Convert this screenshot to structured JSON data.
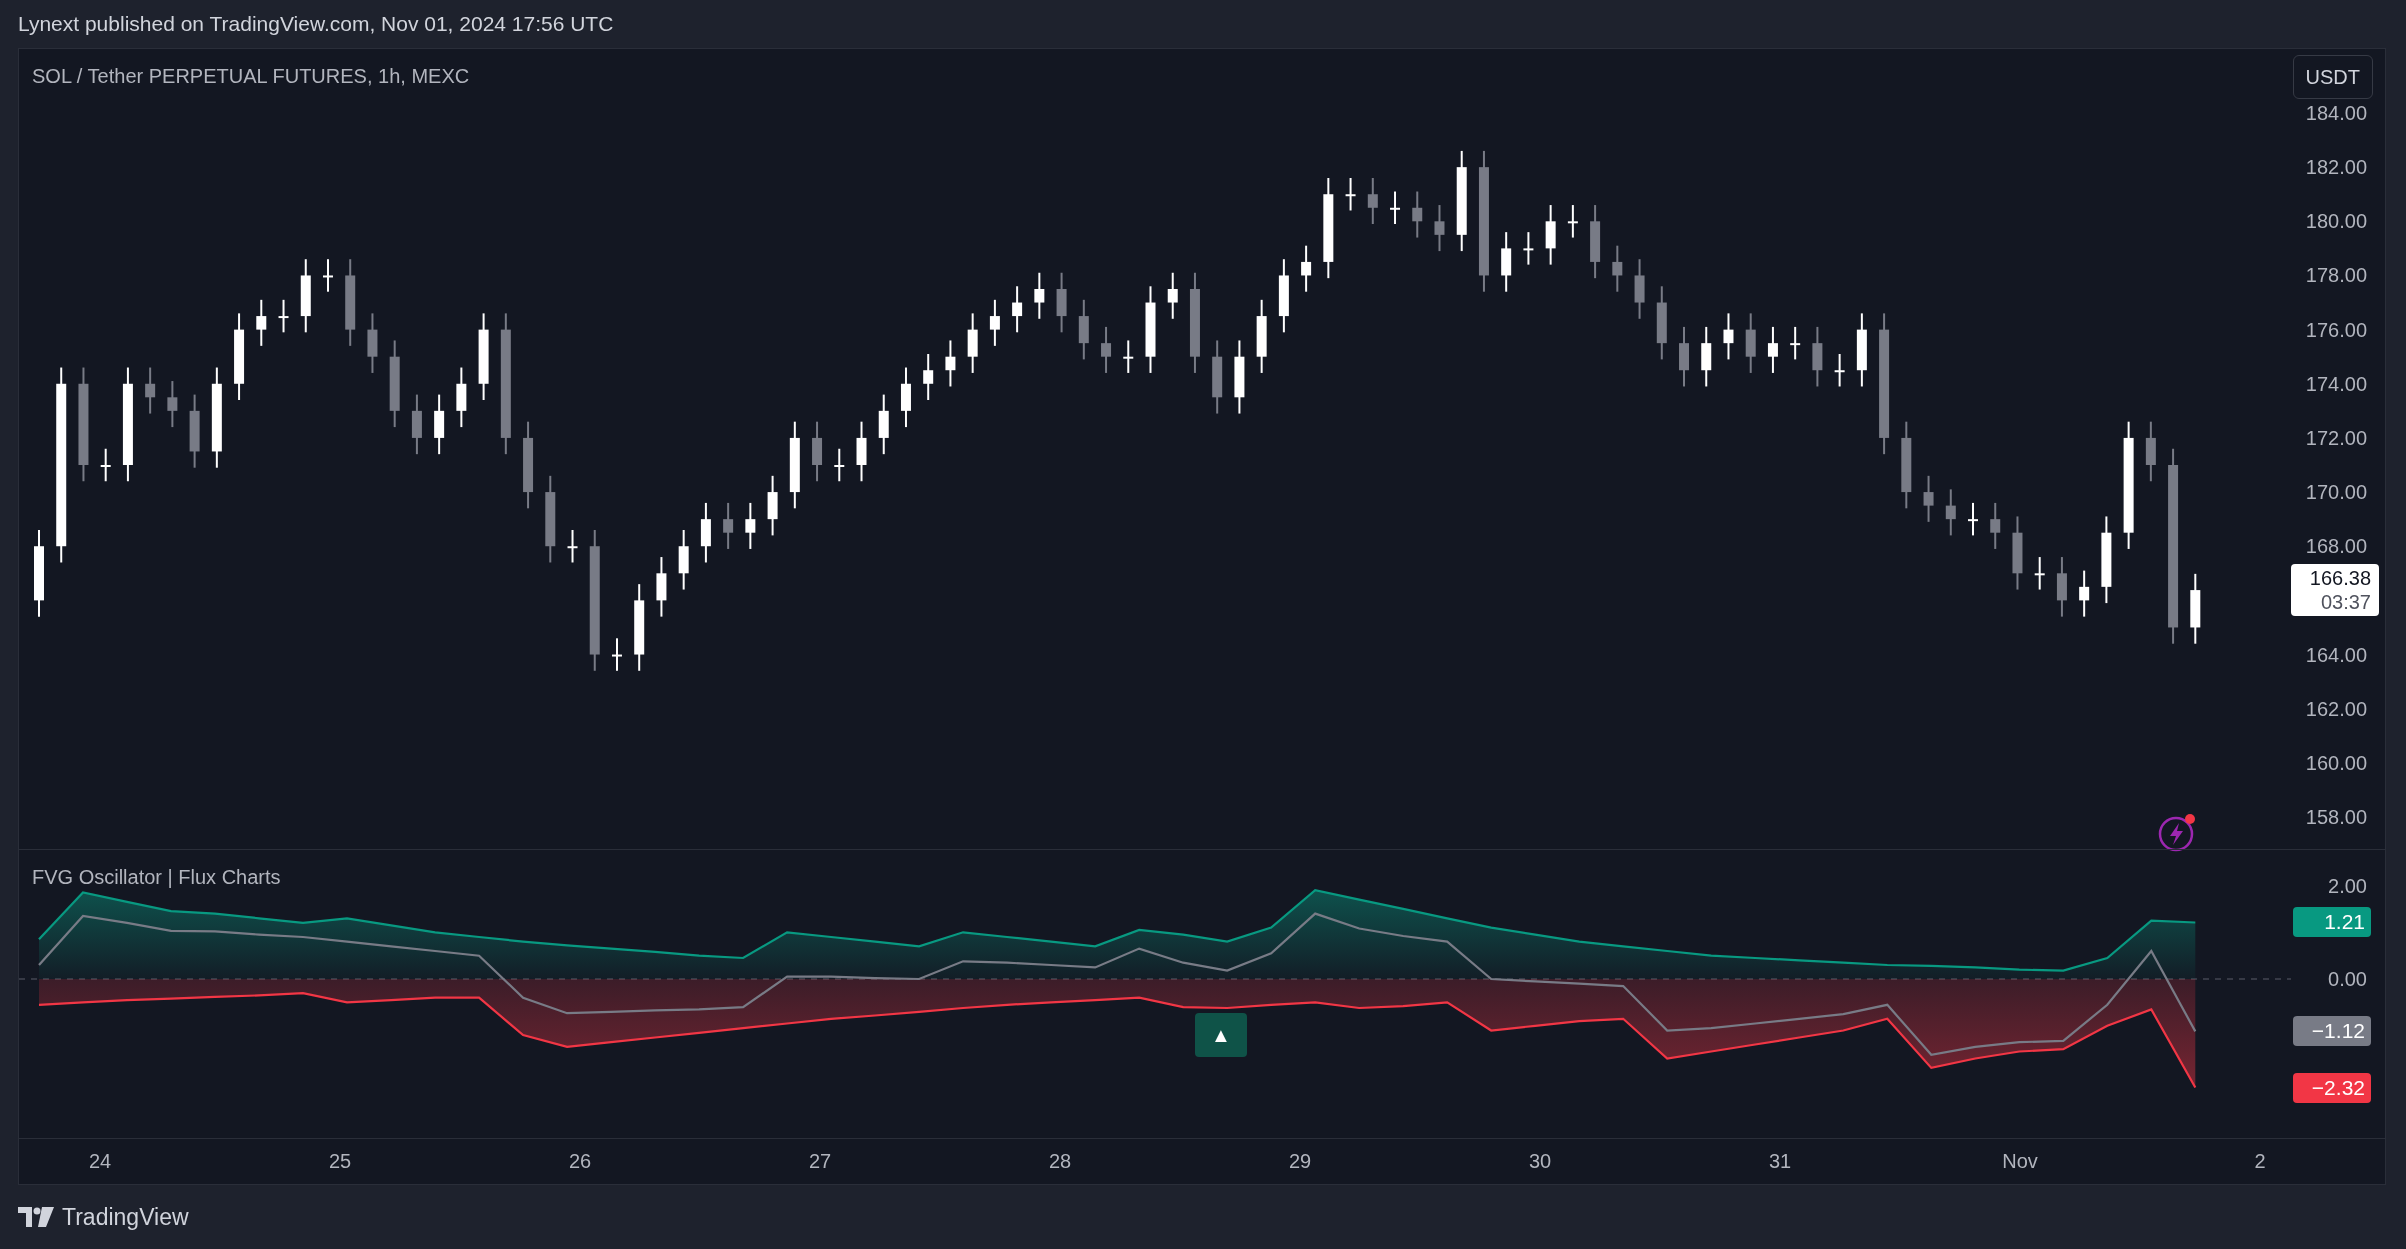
{
  "header": {
    "text": "Lynext published on TradingView.com, Nov 01, 2024 17:56 UTC"
  },
  "price_pane": {
    "symbol": "SOL / Tether PERPETUAL FUTURES, 1h, MEXC",
    "currency_button": "USDT",
    "last_price": "166.38",
    "countdown": "03:37",
    "chart_data": {
      "type": "candlestick",
      "ylim": [
        158,
        184
      ],
      "categories": [
        null,
        null,
        null,
        null,
        null,
        null,
        null,
        null,
        null,
        null,
        null,
        null,
        null,
        null,
        null,
        null,
        null,
        null,
        null,
        null,
        null,
        null,
        null,
        null,
        null,
        null,
        null,
        null,
        null,
        null,
        null,
        null,
        null,
        null,
        null,
        null,
        null,
        null,
        null,
        null,
        null,
        null,
        null,
        null,
        null,
        null,
        null,
        null,
        null,
        null,
        null,
        null,
        null,
        null,
        null,
        null,
        null,
        null,
        null,
        null,
        null,
        null,
        null,
        null,
        null,
        null,
        null,
        null,
        null,
        null,
        null,
        null,
        null,
        null,
        null,
        null,
        null,
        null,
        null,
        null,
        null,
        null,
        null,
        null,
        null,
        null,
        null,
        null,
        null,
        null,
        null,
        null,
        null,
        null,
        null,
        null,
        null,
        null
      ],
      "ohlc": [
        [
          166,
          168.6,
          165.4,
          168
        ],
        [
          168,
          174.6,
          167.4,
          174
        ],
        [
          174,
          174.6,
          170.4,
          171
        ],
        [
          171,
          171.6,
          170.4,
          171
        ],
        [
          171,
          174.6,
          170.4,
          174
        ],
        [
          174,
          174.6,
          172.9,
          173.5
        ],
        [
          173.5,
          174.1,
          172.4,
          173
        ],
        [
          173,
          173.6,
          170.9,
          171.5
        ],
        [
          171.5,
          174.6,
          170.9,
          174
        ],
        [
          174,
          176.6,
          173.4,
          176
        ],
        [
          176,
          177.1,
          175.4,
          176.5
        ],
        [
          176.5,
          177.1,
          175.9,
          176.5
        ],
        [
          176.5,
          178.6,
          175.9,
          178
        ],
        [
          178,
          178.6,
          177.4,
          178
        ],
        [
          178,
          178.6,
          175.4,
          176
        ],
        [
          176,
          176.6,
          174.4,
          175
        ],
        [
          175,
          175.6,
          172.4,
          173
        ],
        [
          173,
          173.6,
          171.4,
          172
        ],
        [
          172,
          173.6,
          171.4,
          173
        ],
        [
          173,
          174.6,
          172.4,
          174
        ],
        [
          174,
          176.6,
          173.4,
          176
        ],
        [
          176,
          176.6,
          171.4,
          172
        ],
        [
          172,
          172.6,
          169.4,
          170
        ],
        [
          170,
          170.6,
          167.4,
          168
        ],
        [
          168,
          168.6,
          167.4,
          168
        ],
        [
          168,
          168.6,
          163.4,
          164
        ],
        [
          164,
          164.6,
          163.4,
          164
        ],
        [
          164,
          166.6,
          163.4,
          166
        ],
        [
          166,
          167.6,
          165.4,
          167
        ],
        [
          167,
          168.6,
          166.4,
          168
        ],
        [
          168,
          169.6,
          167.4,
          169
        ],
        [
          169,
          169.6,
          167.9,
          168.5
        ],
        [
          168.5,
          169.6,
          167.9,
          169
        ],
        [
          169,
          170.6,
          168.4,
          170
        ],
        [
          170,
          172.6,
          169.4,
          172
        ],
        [
          172,
          172.6,
          170.4,
          171
        ],
        [
          171,
          171.6,
          170.4,
          171
        ],
        [
          171,
          172.6,
          170.4,
          172
        ],
        [
          172,
          173.6,
          171.4,
          173
        ],
        [
          173,
          174.6,
          172.4,
          174
        ],
        [
          174,
          175.1,
          173.4,
          174.5
        ],
        [
          174.5,
          175.6,
          173.9,
          175
        ],
        [
          175,
          176.6,
          174.4,
          176
        ],
        [
          176,
          177.1,
          175.4,
          176.5
        ],
        [
          176.5,
          177.6,
          175.9,
          177
        ],
        [
          177,
          178.1,
          176.4,
          177.5
        ],
        [
          177.5,
          178.1,
          175.9,
          176.5
        ],
        [
          176.5,
          177.1,
          174.9,
          175.5
        ],
        [
          175.5,
          176.1,
          174.4,
          175
        ],
        [
          175,
          175.6,
          174.4,
          175
        ],
        [
          175,
          177.6,
          174.4,
          177
        ],
        [
          177,
          178.1,
          176.4,
          177.5
        ],
        [
          177.5,
          178.1,
          174.4,
          175
        ],
        [
          175,
          175.6,
          172.9,
          173.5
        ],
        [
          173.5,
          175.6,
          172.9,
          175
        ],
        [
          175,
          177.1,
          174.4,
          176.5
        ],
        [
          176.5,
          178.6,
          175.9,
          178
        ],
        [
          178,
          179.1,
          177.4,
          178.5
        ],
        [
          178.5,
          181.6,
          177.9,
          181
        ],
        [
          181,
          181.6,
          180.4,
          181
        ],
        [
          181,
          181.6,
          179.9,
          180.5
        ],
        [
          180.5,
          181.1,
          179.9,
          180.5
        ],
        [
          180.5,
          181.1,
          179.4,
          180
        ],
        [
          180,
          180.6,
          178.9,
          179.5
        ],
        [
          179.5,
          182.6,
          178.9,
          182
        ],
        [
          182,
          182.6,
          177.4,
          178
        ],
        [
          178,
          179.6,
          177.4,
          179
        ],
        [
          179,
          179.6,
          178.4,
          179
        ],
        [
          179,
          180.6,
          178.4,
          180
        ],
        [
          180,
          180.6,
          179.4,
          180
        ],
        [
          180,
          180.6,
          177.9,
          178.5
        ],
        [
          178.5,
          179.1,
          177.4,
          178
        ],
        [
          178,
          178.6,
          176.4,
          177
        ],
        [
          177,
          177.6,
          174.9,
          175.5
        ],
        [
          175.5,
          176.1,
          173.9,
          174.5
        ],
        [
          174.5,
          176.1,
          173.9,
          175.5
        ],
        [
          175.5,
          176.6,
          174.9,
          176
        ],
        [
          176,
          176.6,
          174.4,
          175
        ],
        [
          175,
          176.1,
          174.4,
          175.5
        ],
        [
          175.5,
          176.1,
          174.9,
          175.5
        ],
        [
          175.5,
          176.1,
          173.9,
          174.5
        ],
        [
          174.5,
          175.1,
          173.9,
          174.5
        ],
        [
          174.5,
          176.6,
          173.9,
          176
        ],
        [
          176,
          176.6,
          171.4,
          172
        ],
        [
          172,
          172.6,
          169.4,
          170
        ],
        [
          170,
          170.6,
          168.9,
          169.5
        ],
        [
          169.5,
          170.1,
          168.4,
          169
        ],
        [
          169,
          169.6,
          168.4,
          169
        ],
        [
          169,
          169.6,
          167.9,
          168.5
        ],
        [
          168.5,
          169.1,
          166.4,
          167
        ],
        [
          167,
          167.6,
          166.4,
          167
        ],
        [
          167,
          167.6,
          165.4,
          166
        ],
        [
          166,
          167.1,
          165.4,
          166.5
        ],
        [
          166.5,
          169.1,
          165.9,
          168.5
        ],
        [
          168.5,
          172.6,
          167.9,
          172
        ],
        [
          172,
          172.6,
          170.4,
          171
        ],
        [
          171,
          171.6,
          164.4,
          165
        ],
        [
          165,
          166.98,
          164.4,
          166.38
        ]
      ],
      "yticks": [
        {
          "value": 184,
          "label": "184.00"
        },
        {
          "value": 182,
          "label": "182.00"
        },
        {
          "value": 180,
          "label": "180.00"
        },
        {
          "value": 178,
          "label": "178.00"
        },
        {
          "value": 176,
          "label": "176.00"
        },
        {
          "value": 174,
          "label": "174.00"
        },
        {
          "value": 172,
          "label": "172.00"
        },
        {
          "value": 170,
          "label": "170.00"
        },
        {
          "value": 168,
          "label": "168.00"
        },
        {
          "value": 164,
          "label": "164.00"
        },
        {
          "value": 162,
          "label": "162.00"
        },
        {
          "value": 160,
          "label": "160.00"
        },
        {
          "value": 158,
          "label": "158.00"
        }
      ]
    }
  },
  "oscillator_pane": {
    "title": "FVG Oscillator | Flux Charts",
    "chart_data": {
      "type": "line",
      "ylim": [
        -3.4,
        2.76
      ],
      "categories": [
        null,
        null,
        null,
        null,
        null,
        null,
        null,
        null,
        null,
        null,
        null,
        null,
        null,
        null,
        null,
        null,
        null,
        null,
        null,
        null,
        null,
        null,
        null,
        null,
        null,
        null,
        null,
        null,
        null,
        null,
        null,
        null,
        null,
        null,
        null,
        null,
        null,
        null,
        null,
        null,
        null,
        null,
        null,
        null,
        null,
        null,
        null,
        null,
        null,
        null
      ],
      "series": [
        {
          "type": "area",
          "color": "#089981",
          "values": [
            0.85,
            1.85,
            1.65,
            1.45,
            1.4,
            1.3,
            1.2,
            1.3,
            1.15,
            1.0,
            0.9,
            0.8,
            0.72,
            0.65,
            0.58,
            0.5,
            0.45,
            1.0,
            0.9,
            0.8,
            0.7,
            1.0,
            0.9,
            0.8,
            0.7,
            1.05,
            0.95,
            0.8,
            1.1,
            1.9,
            1.7,
            1.5,
            1.3,
            1.1,
            0.95,
            0.8,
            0.7,
            0.6,
            0.5,
            0.45,
            0.4,
            0.35,
            0.3,
            0.28,
            0.25,
            0.2,
            0.18,
            0.45,
            1.25,
            1.21
          ]
        },
        {
          "type": "line",
          "color": "#787b86",
          "values": [
            0.3,
            1.35,
            1.2,
            1.03,
            1.02,
            0.95,
            0.9,
            0.8,
            0.7,
            0.6,
            0.5,
            -0.4,
            -0.73,
            -0.7,
            -0.67,
            -0.65,
            -0.6,
            0.05,
            0.05,
            0.02,
            0.0,
            0.38,
            0.35,
            0.3,
            0.25,
            0.65,
            0.35,
            0.18,
            0.55,
            1.4,
            1.08,
            0.92,
            0.8,
            0.0,
            -0.05,
            -0.1,
            -0.15,
            -1.1,
            -1.05,
            -0.95,
            -0.85,
            -0.75,
            -0.55,
            -1.62,
            -1.45,
            -1.35,
            -1.32,
            -0.55,
            0.6,
            -1.12
          ]
        },
        {
          "type": "area",
          "color": "#f23645",
          "values": [
            -0.55,
            -0.5,
            -0.45,
            -0.42,
            -0.38,
            -0.35,
            -0.3,
            -0.5,
            -0.45,
            -0.4,
            -0.4,
            -1.2,
            -1.45,
            -1.35,
            -1.25,
            -1.15,
            -1.05,
            -0.95,
            -0.85,
            -0.78,
            -0.7,
            -0.62,
            -0.55,
            -0.5,
            -0.45,
            -0.4,
            -0.6,
            -0.62,
            -0.55,
            -0.5,
            -0.62,
            -0.58,
            -0.5,
            -1.1,
            -1.0,
            -0.9,
            -0.85,
            -1.7,
            -1.55,
            -1.4,
            -1.25,
            -1.1,
            -0.85,
            -1.9,
            -1.7,
            -1.55,
            -1.5,
            -1.0,
            -0.65,
            -2.32
          ]
        }
      ],
      "yticks": [
        {
          "value": 2,
          "label": "2.00"
        },
        {
          "value": 0,
          "label": "0.00"
        }
      ]
    },
    "signal_label": {
      "text": "▲"
    },
    "last_values": [
      {
        "text": "1.21",
        "color": "#089981"
      },
      {
        "text": "−1.12",
        "color": "#787b86"
      },
      {
        "text": "−2.32",
        "color": "#f23645"
      }
    ]
  },
  "time_axis": [
    "24",
    "25",
    "26",
    "27",
    "28",
    "29",
    "30",
    "31",
    "Nov",
    "2"
  ],
  "footer": {
    "brand": "TradingView"
  }
}
